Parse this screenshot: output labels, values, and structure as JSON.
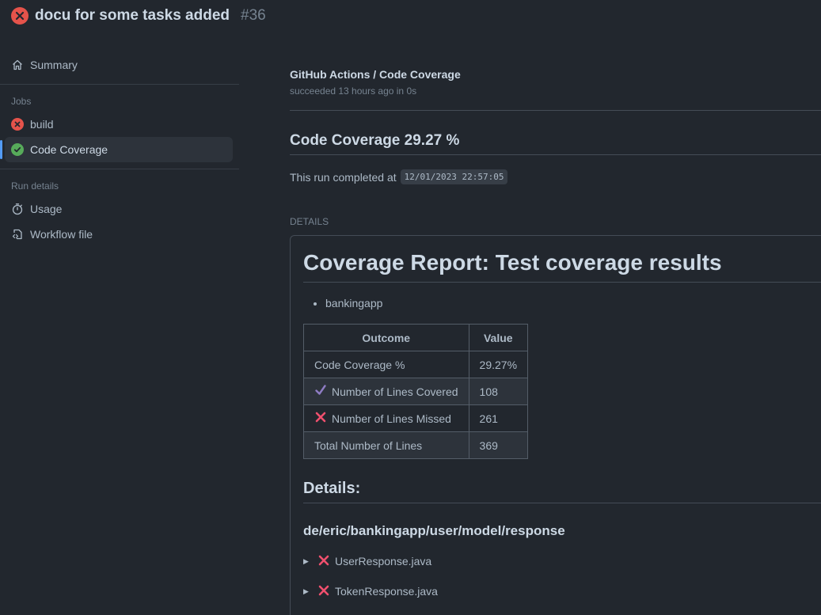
{
  "header": {
    "title": "docu for some tasks added",
    "run_number": "#36"
  },
  "sidebar": {
    "summary_label": "Summary",
    "jobs_heading": "Jobs",
    "jobs": [
      {
        "label": "build",
        "status": "failure"
      },
      {
        "label": "Code Coverage",
        "status": "success",
        "active": true
      }
    ],
    "run_details_heading": "Run details",
    "run_details": [
      {
        "label": "Usage",
        "icon": "stopwatch-icon"
      },
      {
        "label": "Workflow file",
        "icon": "file-code-icon"
      }
    ]
  },
  "job": {
    "title": "GitHub Actions / Code Coverage",
    "meta": "succeeded 13 hours ago in 0s"
  },
  "summary": {
    "heading": "Code Coverage 29.27 %",
    "completed_prefix": "This run completed at",
    "completed_at": "12/01/2023 22:57:05",
    "details_label": "DETAILS"
  },
  "report": {
    "title": "Coverage Report: Test coverage results",
    "packages_list": [
      "bankingapp"
    ],
    "table": {
      "headers": [
        "Outcome",
        "Value"
      ],
      "rows": [
        {
          "icon": "",
          "outcome": "Code Coverage %",
          "value": "29.27%"
        },
        {
          "icon": "check-icon",
          "outcome": "Number of Lines Covered",
          "value": "108"
        },
        {
          "icon": "cross-icon",
          "outcome": "Number of Lines Missed",
          "value": "261"
        },
        {
          "icon": "",
          "outcome": "Total Number of Lines",
          "value": "369"
        }
      ]
    },
    "details_heading": "Details:",
    "package_path": "de/eric/bankingapp/user/model/response",
    "files": [
      {
        "name": "UserResponse.java",
        "status": "missed"
      },
      {
        "name": "TokenResponse.java",
        "status": "missed"
      }
    ]
  },
  "colors": {
    "background": "#22272e",
    "failure": "#e5534b",
    "success": "#57ab5a",
    "accent": "#539bf5",
    "check": "#8e7cc3",
    "cross": "#f0506e"
  }
}
